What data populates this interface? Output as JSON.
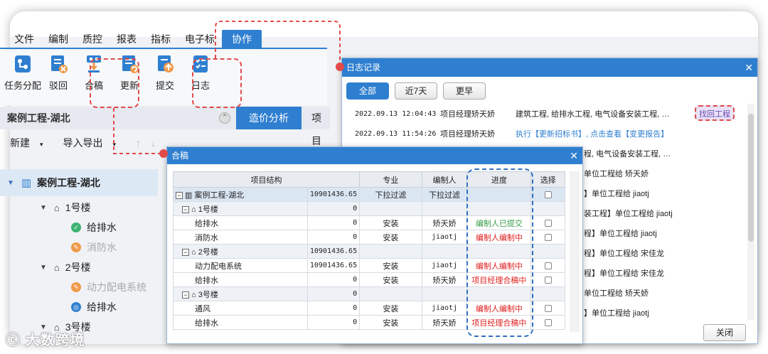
{
  "menu": [
    "文件",
    "编制",
    "质控",
    "报表",
    "指标",
    "电子标",
    "协作"
  ],
  "menu_active": "协作",
  "ribbon": [
    {
      "label": "任务分配",
      "icon": "task-assign-icon"
    },
    {
      "label": "驳回",
      "icon": "reject-icon"
    },
    {
      "label": "合稿",
      "icon": "merge-icon"
    },
    {
      "label": "更新",
      "icon": "update-icon"
    },
    {
      "label": "提交",
      "icon": "submit-icon"
    },
    {
      "label": "日志",
      "icon": "log-icon"
    }
  ],
  "left_panel": {
    "title": "案例工程-湖北",
    "tab_active": "造价分析",
    "tab_other": "项目",
    "toolbar": {
      "new": "新建",
      "import_export": "导入导出"
    },
    "tree": {
      "root": "案例工程-湖北",
      "b1": "1号楼",
      "b1_drain": "给排水",
      "b1_fire": "消防水",
      "b2": "2号楼",
      "b2_power": "动力配电系统",
      "b2_drain": "给排水",
      "b3": "3号楼"
    }
  },
  "log_dialog": {
    "title": "日志记录",
    "filters": [
      "全部",
      "近7天",
      "更早"
    ],
    "retract_label": "找回工程",
    "rows": [
      {
        "time": "2022.09.13 12:04:43",
        "user": "项目经理矫天娇",
        "content": "建筑工程, 给排水工程, 电气设备安装工程, …"
      },
      {
        "time": "2022.09.13 11:54:26",
        "user": "项目经理矫天娇",
        "content": "执行【更新招标书】, 点击查看【变更报告】"
      },
      {
        "content": "程, 电气设备安装工程, …"
      },
      {
        "content": "单位工程给 矫天娇"
      },
      {
        "content": "】单位工程给 jiaotj"
      },
      {
        "content": "装工程】单位工程给 jiaotj"
      },
      {
        "content": "程】单位工程给 jiaotj"
      },
      {
        "content": "程】单位工程给 宋佳龙"
      },
      {
        "content": "程】单位工程给 宋佳龙"
      },
      {
        "content": "单位工程给 矫天娇"
      },
      {
        "content": "】单位工程给 jiaotj"
      }
    ],
    "close_label": "关闭"
  },
  "merge_dialog": {
    "title": "合稿",
    "headers": {
      "structure": "项目结构",
      "major": "专业",
      "editor": "编制人",
      "progress": "进度",
      "select": "选择"
    },
    "root": {
      "name": "案例工程-湖北",
      "amount": "10901436.65",
      "major": "下拉过滤",
      "editor": "下拉过滤"
    },
    "b1": {
      "name": "1号楼",
      "amount": "0"
    },
    "r1": {
      "name": "给排水",
      "amount": "0",
      "major": "安装",
      "editor": "矫天娇",
      "progress": "编制人已提交"
    },
    "r2": {
      "name": "消防水",
      "amount": "0",
      "major": "安装",
      "editor": "jiaotj",
      "progress": "编制人编制中"
    },
    "b2": {
      "name": "2号楼",
      "amount": "10901436.65"
    },
    "r3": {
      "name": "动力配电系统",
      "amount": "10901436.65",
      "major": "安装",
      "editor": "jiaotj",
      "progress": "编制人编制中"
    },
    "r4": {
      "name": "给排水",
      "amount": "0",
      "major": "安装",
      "editor": "矫天娇",
      "progress": "项目经理合稿中"
    },
    "b3": {
      "name": "3号楼",
      "amount": "0"
    },
    "r5": {
      "name": "通风",
      "amount": "0",
      "major": "安装",
      "editor": "jiaotj",
      "progress": "编制人编制中"
    },
    "r6": {
      "name": "给排水",
      "amount": "0",
      "major": "安装",
      "editor": "矫天娇",
      "progress": "项目经理合稿中"
    }
  },
  "watermark": "大数跨境",
  "colors": {
    "accent": "#2f7fd0",
    "annotation_red": "#e24a4a",
    "progress_green": "#3aa04a",
    "progress_red": "#e02020"
  }
}
